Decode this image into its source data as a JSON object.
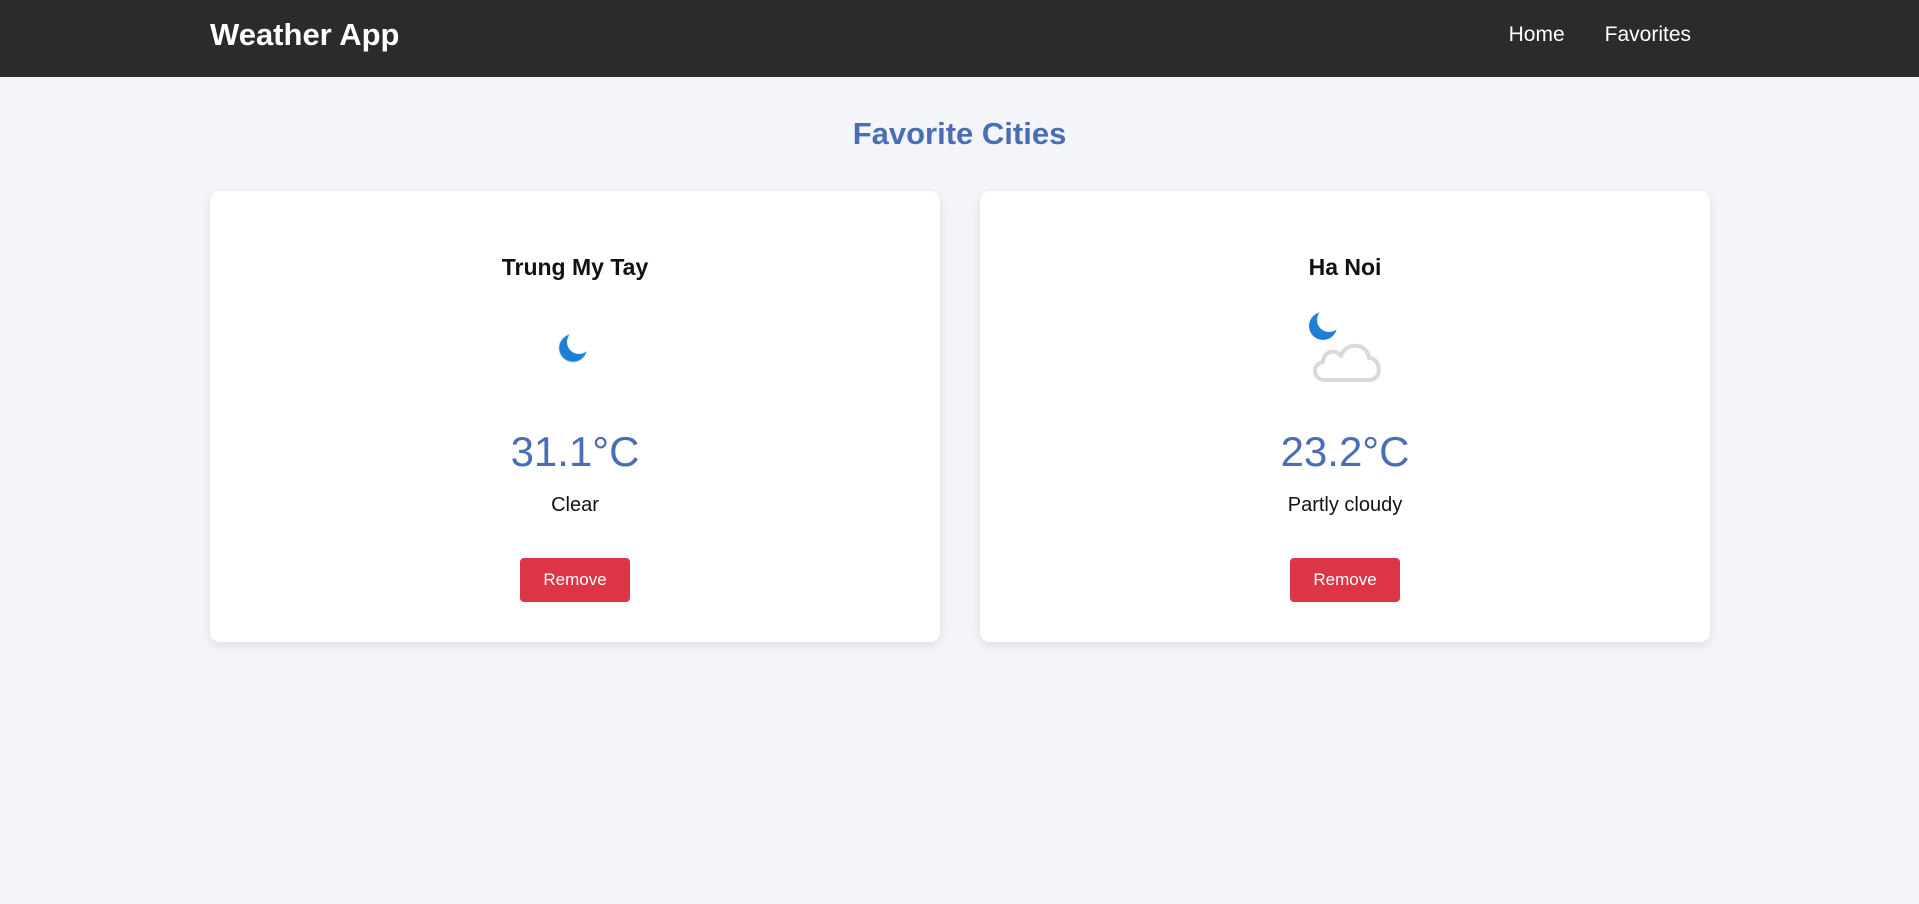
{
  "navbar": {
    "brand": "Weather App",
    "links": [
      "Home",
      "Favorites"
    ]
  },
  "page": {
    "title": "Favorite Cities"
  },
  "favorites": [
    {
      "city": "Trung My Tay",
      "icon": "moon-icon",
      "temperature": "31.1°C",
      "condition": "Clear",
      "remove_label": "Remove"
    },
    {
      "city": "Ha Noi",
      "icon": "moon-cloud-icon",
      "temperature": "23.2°C",
      "condition": "Partly cloudy",
      "remove_label": "Remove"
    }
  ],
  "colors": {
    "navbar_bg": "#2b2b2b",
    "page_bg": "#f4f5f9",
    "accent_blue": "#4a6db5",
    "remove_red": "#dc3545",
    "moon_blue": "#1e7fd6",
    "cloud_gray": "#d9d9d9"
  }
}
